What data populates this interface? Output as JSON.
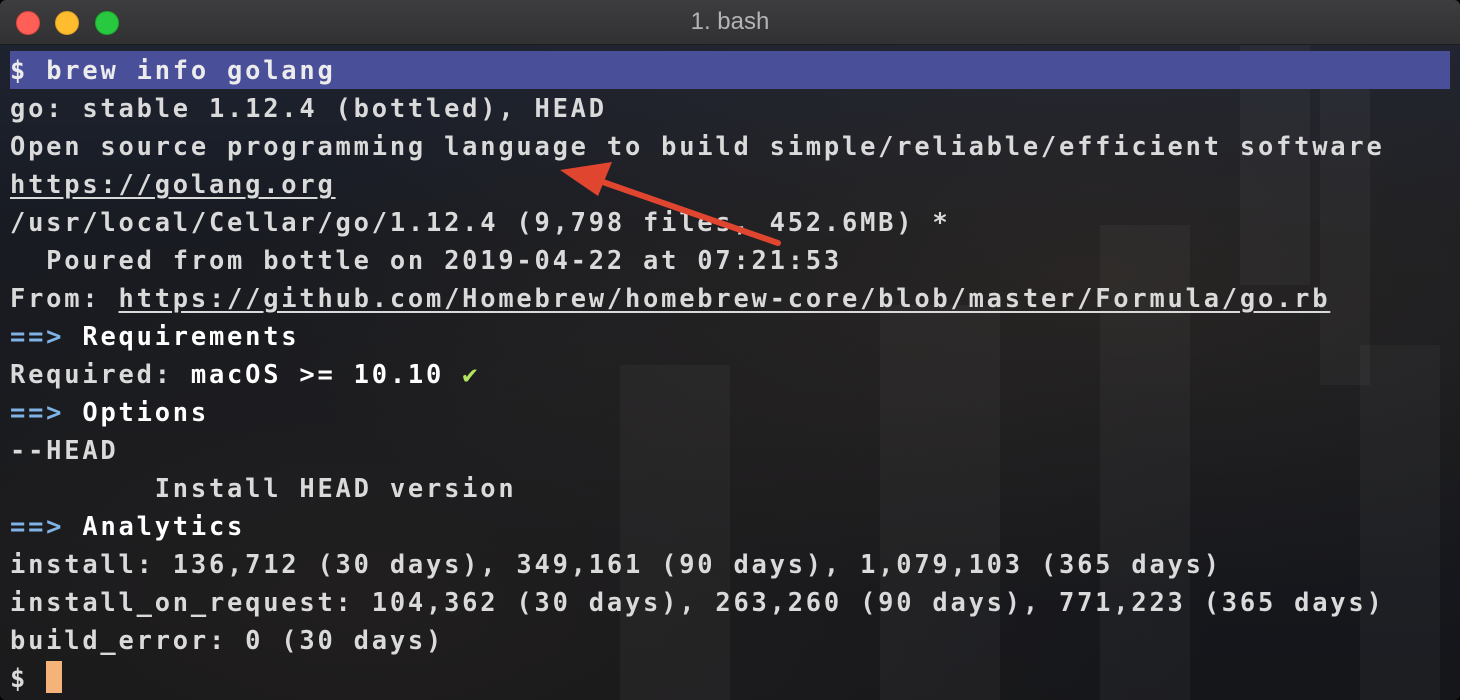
{
  "window": {
    "title": "1. bash"
  },
  "terminal": {
    "prompt_symbol": "$",
    "command": "brew info golang",
    "line_1": "go: stable 1.12.4 (bottled), HEAD",
    "line_2": "Open source programming language to build simple/reliable/efficient software",
    "homepage_url": "https://golang.org",
    "line_4": "/usr/local/Cellar/go/1.12.4 (9,798 files, 452.6MB) *",
    "line_5": "  Poured from bottle on 2019-04-22 at 07:21:53",
    "from_label": "From: ",
    "from_url": "https://github.com/Homebrew/homebrew-core/blob/master/Formula/go.rb",
    "section_arrow": "==>",
    "section_requirements": "Requirements",
    "required_label": "Required: ",
    "required_value": "macOS >= 10.10",
    "check_glyph": "✔",
    "section_options": "Options",
    "option_flag": "--HEAD",
    "option_desc": "        Install HEAD version",
    "section_analytics": "Analytics",
    "install_line": "install: 136,712 (30 days), 349,161 (90 days), 1,079,103 (365 days)",
    "install_on_request_line": "install_on_request: 104,362 (30 days), 263,260 (90 days), 771,223 (365 days)",
    "build_error_line": "build_error: 0 (30 days)",
    "final_prompt": "$ "
  },
  "colors": {
    "command_highlight": "#4a4f9a",
    "section_arrow": "#7fb2e5",
    "check": "#b2e55f",
    "cursor": "#f5b37a",
    "annotation_arrow": "#e0452f"
  }
}
